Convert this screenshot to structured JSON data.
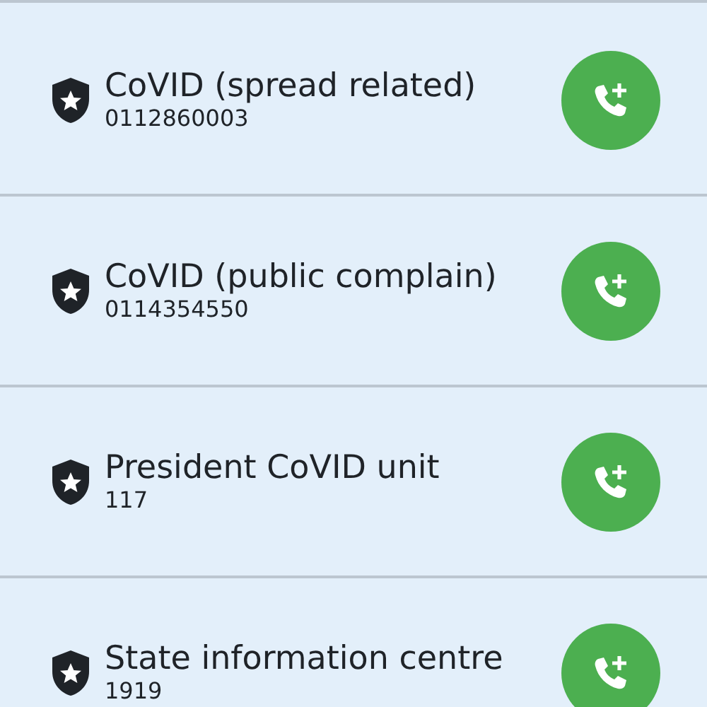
{
  "contacts": [
    {
      "name": "CoVID (spread related)",
      "number": "0112860003"
    },
    {
      "name": "CoVID (public complain)",
      "number": "0114354550"
    },
    {
      "name": "President CoVID unit",
      "number": "117"
    },
    {
      "name": "State information centre",
      "number": "1919"
    }
  ]
}
